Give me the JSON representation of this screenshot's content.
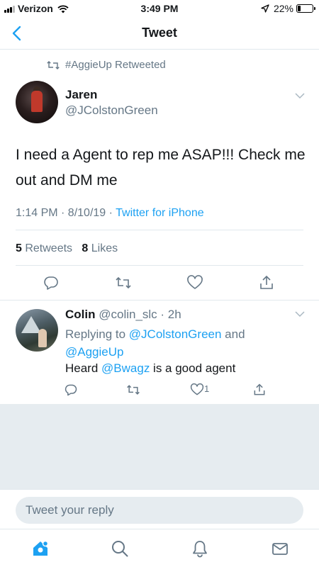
{
  "status_bar": {
    "carrier": "Verizon",
    "time": "3:49 PM",
    "battery_percent": "22%",
    "battery_level": 0.22
  },
  "nav": {
    "title": "Tweet",
    "back_icon": "chevron-left-icon"
  },
  "tweet": {
    "retweet_context": "#AggieUp Retweeted",
    "author_name": "Jaren",
    "author_handle": "@JColstonGreen",
    "text": "I need a Agent to rep me ASAP!!! Check me out and DM me",
    "time": "1:14 PM · 8/10/19 · ",
    "source": "Twitter for iPhone",
    "retweets_count": "5",
    "retweets_label": " Retweets",
    "likes_count": "8",
    "likes_label": " Likes"
  },
  "reply": {
    "name": "Colin",
    "handle": "@colin_slc",
    "time": " · 2h",
    "replying_prefix": "Replying to ",
    "replying_user_1": "@JColstonGreen",
    "replying_and": " and",
    "replying_user_2": "@AggieUp",
    "text_before": "Heard ",
    "mention": "@Bwagz",
    "text_after": " is a good agent",
    "like_count": "1"
  },
  "compose": {
    "placeholder": "Tweet your reply"
  },
  "tab_bar": {
    "items": [
      "home-icon",
      "search-icon",
      "notifications-icon",
      "messages-icon"
    ]
  },
  "colors": {
    "accent": "#1da1f2",
    "muted": "#657786",
    "divider": "#e1e8ed",
    "background_gray": "#e6ecf0"
  }
}
